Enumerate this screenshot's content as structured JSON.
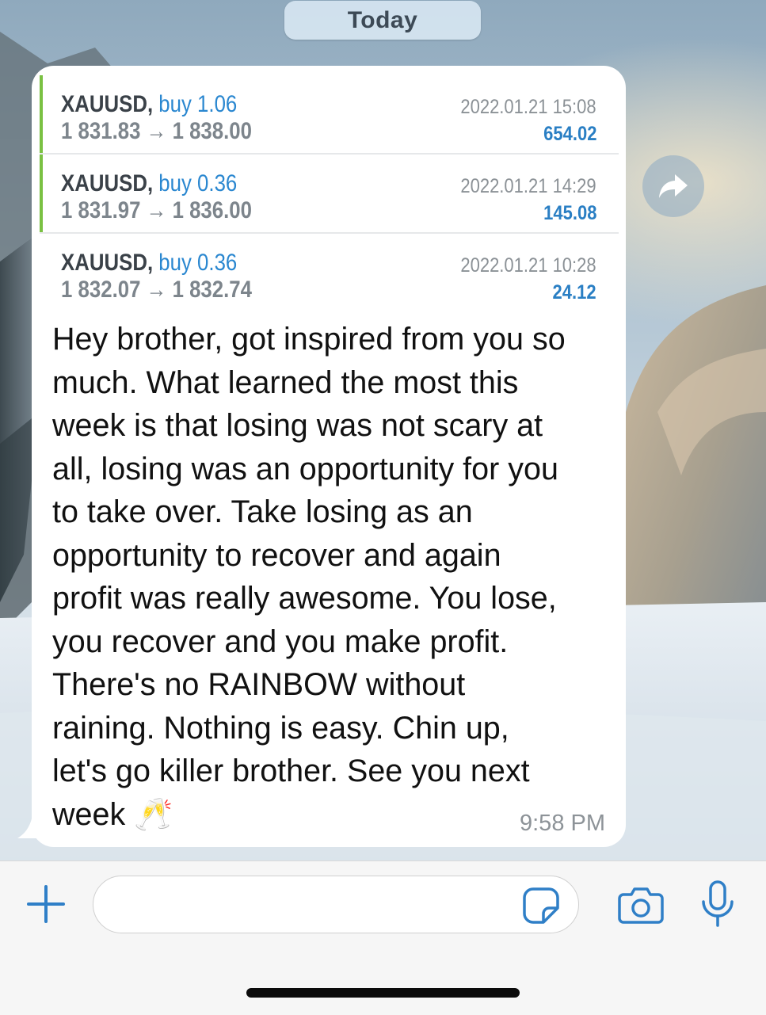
{
  "header": {
    "date_label": "Today"
  },
  "message": {
    "trades": [
      {
        "symbol": "XAUUSD,",
        "side": "buy 1.06",
        "prices": "1 831.83 → 1 838.00",
        "timestamp": "2022.01.21 15:08",
        "profit": "654.02"
      },
      {
        "symbol": "XAUUSD,",
        "side": "buy 0.36",
        "prices": "1 831.97 → 1 836.00",
        "timestamp": "2022.01.21 14:29",
        "profit": "145.08"
      },
      {
        "symbol": "XAUUSD,",
        "side": "buy 0.36",
        "prices": "1 832.07 → 1 832.74",
        "timestamp": "2022.01.21 10:28",
        "profit": "24.12"
      }
    ],
    "text": "Hey brother, got inspired from you so\nmuch. What learned the most this\nweek is that losing was not scary at\nall, losing was an opportunity for you\nto take over. Take losing as an\nopportunity to recover and again\nprofit was really awesome. You lose,\nyou recover and you make profit.\nThere's no RAINBOW without\nraining. Nothing is easy. Chin up,\nlet's go killer brother. See you next\nweek 🥂",
    "time": "9:58 PM",
    "forward_icon": "share-arrow-icon"
  },
  "composer": {
    "input_value": "",
    "icons": [
      "plus-icon",
      "sticker-icon",
      "camera-icon",
      "microphone-icon"
    ]
  },
  "colors": {
    "buy_accent": "#2a87d0",
    "profit": "#2a7fc4",
    "trade_bar": "#7ac142",
    "ui_icon": "#2f7fc7"
  }
}
